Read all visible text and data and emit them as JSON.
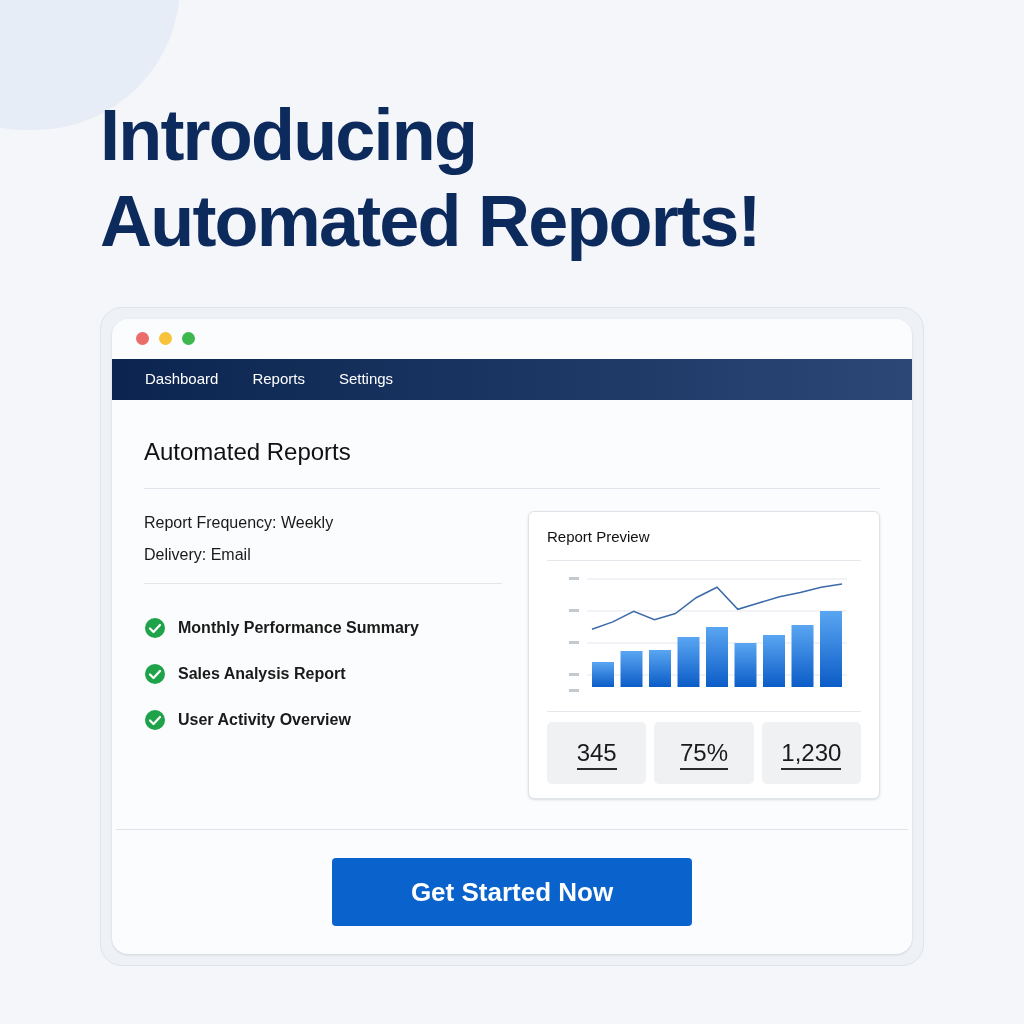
{
  "headline": [
    "Introducing",
    "Automated Reports!"
  ],
  "nav": {
    "items": [
      {
        "label": "Dashboard"
      },
      {
        "label": "Reports"
      },
      {
        "label": "Settings"
      }
    ]
  },
  "page_title": "Automated Reports",
  "settings": [
    {
      "label": "Report Frequency:",
      "value": "Weekly"
    },
    {
      "label": "Delivery:",
      "value": "Email"
    }
  ],
  "report_list": [
    {
      "label": "Monthly Performance Summary",
      "checked": true
    },
    {
      "label": "Sales Analysis Report",
      "checked": true
    },
    {
      "label": "User Activity Overview",
      "checked": true
    }
  ],
  "preview": {
    "title": "Report Preview",
    "stats": [
      "345",
      "75%",
      "1,230"
    ]
  },
  "cta_button": "Get Started Now"
}
